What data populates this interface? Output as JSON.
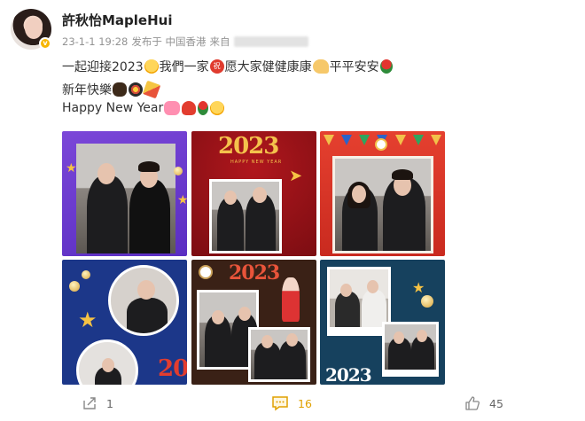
{
  "user": {
    "name": "許秋怡MapleHui",
    "verified_badge": "v"
  },
  "meta": {
    "time": "23-1-1 19:28",
    "location": "发布于 中国香港",
    "from": "来自"
  },
  "post": {
    "line1": {
      "part1": "一起迎接2023",
      "part2": "我們一家",
      "forbid_glyph": "祝",
      "part3": "愿大家健健康康",
      "part4": "平平安安"
    },
    "line2": "新年快樂",
    "line3": "Happy New Year"
  },
  "images": {
    "tile2_text": "2023",
    "tile2_sub": "HAPPY NEW YEAR",
    "tile4_text": "20",
    "tile5_text": "2023",
    "tile6_text": "2023"
  },
  "actions": {
    "share_count": "1",
    "comment_count": "16",
    "like_count": "45"
  },
  "colors": {
    "accent": "#e0a100",
    "text": "#333333",
    "meta": "#939393"
  }
}
